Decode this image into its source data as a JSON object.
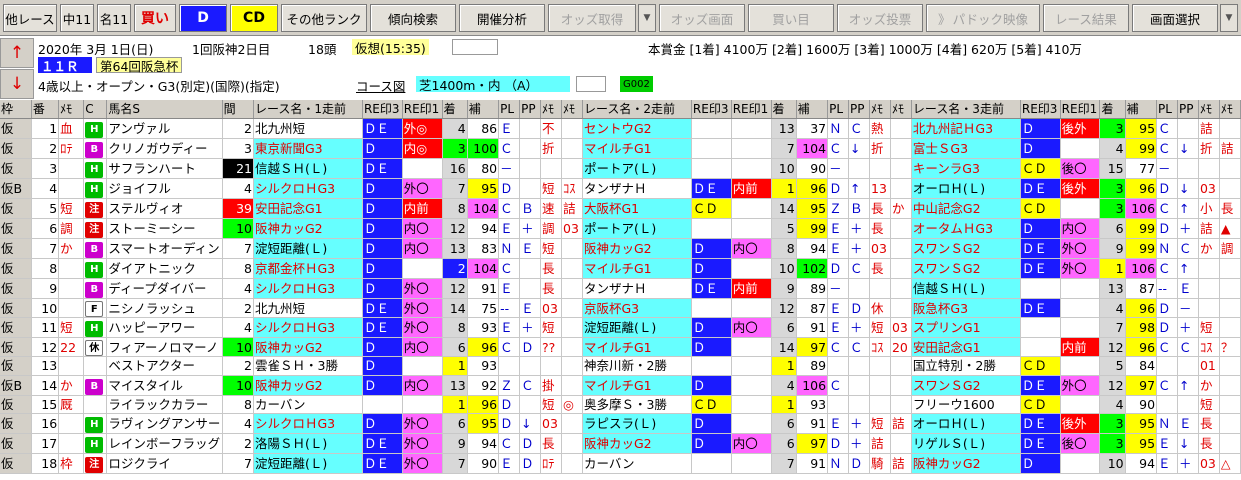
{
  "toolbar": {
    "items": [
      "他レース",
      "中11",
      "名11",
      "買い",
      "D",
      "CD",
      "その他ランク",
      "傾向検索",
      "開催分析",
      "オッズ取得",
      "オッズ画面",
      "買い目",
      "オッズ投票",
      "パドック映像",
      "レース結果",
      "画面選択"
    ]
  },
  "info": {
    "date": "2020年 3月 1日(日)",
    "kaisai": "1回阪神2日目",
    "heads": "18頭",
    "kaso": "仮想(15:35)",
    "prize": "本賞金 [1着] 4100万 [2着] 1600万 [3着] 1000万 [4着] 620万 [5着] 410万",
    "race_no": "１１Ｒ",
    "race_name": "第64回阪急杯",
    "cond": "4歳以上・オープン・G3(別定)(国際)(指定)",
    "course_label": "コース図",
    "course": "芝1400m・内 （A）",
    "code": "G002",
    "up_arrow": "↑",
    "down_arrow": "↓"
  },
  "header": [
    "枠",
    "番",
    "ﾒﾓ",
    "C",
    "馬名S",
    "間",
    "レース名・1走前",
    "RE印3",
    "RE印1",
    "着",
    "補",
    "PL",
    "PP",
    "ﾒﾓ",
    "ﾒﾓ",
    "レース名・2走前",
    "RE印3",
    "RE印1",
    "着",
    "補",
    "PL",
    "PP",
    "ﾒﾓ",
    "ﾒﾓ",
    "レース名・3走前",
    "RE印3",
    "RE印1",
    "着",
    "補",
    "PL",
    "PP",
    "ﾒﾓ",
    "ﾒﾓ"
  ],
  "rows": [
    [
      "仮",
      "1",
      "血",
      "H",
      "アンヴァル",
      "2",
      "北九州短",
      "ＤＥ",
      "外◎",
      "4",
      "86",
      "Ｅ",
      "",
      "不",
      "",
      "セントウG2",
      "",
      "",
      "13",
      "37",
      "Ｎ",
      "Ｃ",
      "熱",
      "",
      "北九州記ＨG3",
      "Ｄ",
      "後外",
      "3",
      "95",
      "Ｃ",
      "",
      "詰",
      ""
    ],
    [
      "仮",
      "2",
      "ﾛﾃ",
      "B",
      "クリノガウディー",
      "3",
      "東京新聞G3",
      "Ｄ",
      "内◎",
      "3",
      "100",
      "Ｃ",
      "",
      "折",
      "",
      "マイルチG1",
      "",
      "",
      "7",
      "104",
      "Ｃ",
      "↓",
      "折",
      "",
      "富士ＳG3",
      "Ｄ",
      "",
      "4",
      "99",
      "Ｃ",
      "↓",
      "折",
      "詰"
    ],
    [
      "仮",
      "3",
      "",
      "H",
      "サフランハート",
      "21",
      "信越ＳＨ(Ｌ)",
      "ＤＥ",
      "",
      "16",
      "80",
      "－",
      "",
      "",
      "",
      "ポートア(Ｌ)",
      "",
      "",
      "10",
      "90",
      "－",
      "",
      "",
      "",
      "キーンラG3",
      "ＣＤ",
      "後〇",
      "15",
      "77",
      "－",
      "",
      "",
      ""
    ],
    [
      "仮B",
      "4",
      "",
      "H",
      "ジョイフル",
      "4",
      "シルクロＨG3",
      "Ｄ",
      "外〇",
      "7",
      "95",
      "Ｄ",
      "",
      "短",
      "ｺｽ",
      "タンザナＨ",
      "ＤＥ",
      "内前",
      "1",
      "96",
      "Ｄ",
      "↑",
      "13",
      "",
      "オーロＨ(Ｌ)",
      "ＤＥ",
      "後外",
      "3",
      "96",
      "Ｄ",
      "↓",
      "03",
      ""
    ],
    [
      "仮",
      "5",
      "短",
      "R",
      "ステルヴィオ",
      "39",
      "安田記念G1",
      "Ｄ",
      "内前",
      "8",
      "104",
      "Ｃ",
      "Ｂ",
      "速",
      "詰",
      "大阪杯G1",
      "ＣＤ",
      "",
      "14",
      "95",
      "Ｚ",
      "Ｂ",
      "長",
      "か",
      "中山記念G2",
      "ＣＤ",
      "",
      "3",
      "106",
      "Ｃ",
      "↑",
      "小",
      "長"
    ],
    [
      "仮",
      "6",
      "調",
      "R",
      "ストーミーシー",
      "10",
      "阪神カッG2",
      "Ｄ",
      "内〇",
      "12",
      "94",
      "Ｅ",
      "＋",
      "調",
      "03",
      "ポートア(Ｌ)",
      "",
      "",
      "5",
      "99",
      "Ｅ",
      "＋",
      "長",
      "",
      "オータムＨG3",
      "Ｄ",
      "内〇",
      "6",
      "99",
      "Ｄ",
      "＋",
      "詰",
      "▲"
    ],
    [
      "仮",
      "7",
      "か",
      "B",
      "スマートオーディン",
      "7",
      "淀短距離(Ｌ)",
      "Ｄ",
      "内〇",
      "13",
      "83",
      "Ｎ",
      "Ｅ",
      "短",
      "",
      "阪神カッG2",
      "Ｄ",
      "内〇",
      "8",
      "94",
      "Ｅ",
      "＋",
      "03",
      "",
      "スワンＳG2",
      "ＤＥ",
      "外〇",
      "9",
      "99",
      "Ｎ",
      "Ｃ",
      "か",
      "調"
    ],
    [
      "仮",
      "8",
      "",
      "H",
      "ダイアトニック",
      "8",
      "京都金杯ＨG3",
      "Ｄ",
      "",
      "2",
      "104",
      "Ｃ",
      "",
      "長",
      "",
      "マイルチG1",
      "Ｄ",
      "",
      "10",
      "102",
      "Ｄ",
      "Ｃ",
      "長",
      "",
      "スワンＳG2",
      "ＤＥ",
      "外〇",
      "1",
      "106",
      "Ｃ",
      "↑",
      "",
      ""
    ],
    [
      "仮",
      "9",
      "",
      "B",
      "ディープダイバー",
      "4",
      "シルクロＨG3",
      "Ｄ",
      "外〇",
      "12",
      "91",
      "Ｅ",
      "",
      "長",
      "",
      "タンザナＨ",
      "ＤＥ",
      "内前",
      "9",
      "89",
      "－",
      "",
      "",
      "",
      "信越ＳＨ(Ｌ)",
      "",
      "",
      "13",
      "87",
      "--",
      "Ｅ",
      "",
      ""
    ],
    [
      "仮",
      "10",
      "",
      "F",
      "ニシノラッシュ",
      "2",
      "北九州短",
      "ＤＥ",
      "外〇",
      "14",
      "75",
      "--",
      "Ｅ",
      "03",
      "",
      "京阪杯G3",
      "",
      "",
      "12",
      "87",
      "Ｅ",
      "Ｄ",
      "休",
      "",
      "阪急杯G3",
      "ＤＥ",
      "",
      "4",
      "96",
      "Ｄ",
      "－",
      "",
      ""
    ],
    [
      "仮",
      "11",
      "短",
      "H",
      "ハッピーアワー",
      "4",
      "シルクロＨG3",
      "ＤＥ",
      "外〇",
      "8",
      "93",
      "Ｅ",
      "＋",
      "短",
      "",
      "淀短距離(Ｌ)",
      "Ｄ",
      "内〇",
      "6",
      "91",
      "Ｅ",
      "＋",
      "短",
      "03",
      "スプリンG1",
      "",
      "",
      "7",
      "98",
      "Ｄ",
      "＋",
      "短",
      ""
    ],
    [
      "仮",
      "12",
      "22",
      "休",
      "フィアーノロマーノ",
      "10",
      "阪神カッG2",
      "Ｄ",
      "内〇",
      "6",
      "96",
      "Ｃ",
      "Ｄ",
      "??",
      "",
      "マイルチG1",
      "Ｄ",
      "",
      "14",
      "97",
      "Ｃ",
      "Ｃ",
      "ｺｽ",
      "20",
      "安田記念G1",
      "",
      "内前",
      "12",
      "96",
      "Ｃ",
      "Ｃ",
      "ｺｽ",
      "？"
    ],
    [
      "仮",
      "13",
      "",
      "",
      "ベストアクター",
      "2",
      "雲雀ＳＨ・3勝",
      "Ｄ",
      "",
      "1",
      "93",
      "",
      "",
      "",
      "",
      "神奈川新・2勝",
      "",
      "",
      "1",
      "89",
      "",
      "",
      "",
      "",
      "国立特別・2勝",
      "ＣＤ",
      "",
      "5",
      "84",
      "",
      "",
      "01",
      ""
    ],
    [
      "仮B",
      "14",
      "か",
      "B",
      "マイスタイル",
      "10",
      "阪神カッG2",
      "Ｄ",
      "内〇",
      "13",
      "92",
      "Ｚ",
      "Ｃ",
      "掛",
      "",
      "マイルチG1",
      "Ｄ",
      "",
      "4",
      "106",
      "Ｃ",
      "",
      "",
      "",
      "スワンＳG2",
      "ＤＥ",
      "外〇",
      "12",
      "97",
      "Ｃ",
      "↑",
      "か",
      ""
    ],
    [
      "仮",
      "15",
      "厩",
      "",
      "ライラックカラー",
      "8",
      "カーバン",
      "",
      "",
      "1",
      "96",
      "Ｄ",
      "",
      "短",
      "◎",
      "奥多摩Ｓ・3勝",
      "ＣＤ",
      "",
      "1",
      "93",
      "",
      "",
      "",
      "",
      "フリーウ1600",
      "ＣＤ",
      "",
      "4",
      "90",
      "",
      "",
      "短",
      ""
    ],
    [
      "仮",
      "16",
      "",
      "H",
      "ラヴィングアンサー",
      "4",
      "シルクロＨG3",
      "Ｄ",
      "外〇",
      "6",
      "95",
      "Ｄ",
      "↓",
      "03",
      "",
      "ラピスラ(Ｌ)",
      "Ｄ",
      "",
      "6",
      "91",
      "Ｅ",
      "＋",
      "短",
      "詰",
      "オーロＨ(Ｌ)",
      "ＤＥ",
      "後外",
      "3",
      "95",
      "Ｎ",
      "Ｅ",
      "長",
      ""
    ],
    [
      "仮",
      "17",
      "",
      "H",
      "レインボーフラッグ",
      "2",
      "洛陽ＳＨ(Ｌ)",
      "ＤＥ",
      "外〇",
      "9",
      "94",
      "Ｃ",
      "Ｄ",
      "長",
      "",
      "阪神カッG2",
      "Ｄ",
      "内〇",
      "6",
      "97",
      "Ｄ",
      "＋",
      "詰",
      "",
      "リゲルＳ(Ｌ)",
      "ＤＥ",
      "後〇",
      "3",
      "95",
      "Ｅ",
      "↓",
      "長",
      ""
    ],
    [
      "仮",
      "18",
      "枠",
      "R",
      "ロジクライ",
      "7",
      "淀短距離(Ｌ)",
      "ＤＥ",
      "外〇",
      "7",
      "90",
      "Ｅ",
      "Ｄ",
      "ﾛﾃ",
      "",
      "カーバン",
      "",
      "",
      "7",
      "91",
      "Ｎ",
      "Ｄ",
      "騎",
      "詰",
      "阪神カッG2",
      "Ｄ",
      "",
      "10",
      "94",
      "Ｅ",
      "＋",
      "03",
      "△"
    ]
  ]
}
